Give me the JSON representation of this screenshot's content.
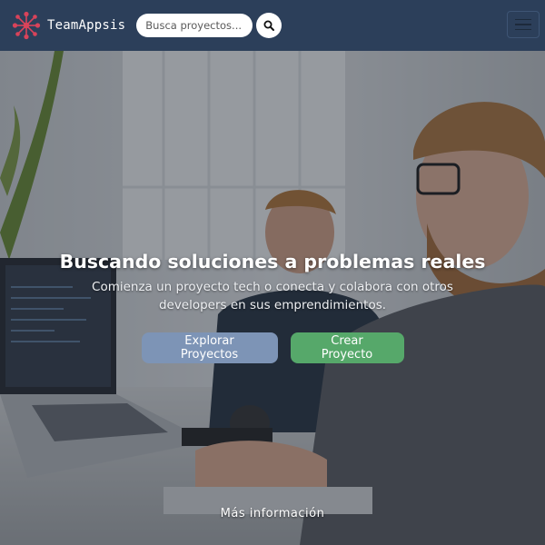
{
  "navbar": {
    "brand_name": "TeamAppsis",
    "logo_icon": "team-network-logo",
    "search_placeholder": "Busca proyectos...",
    "search_icon": "search-icon",
    "menu_icon": "hamburger-menu-icon",
    "colors": {
      "background": "#2c3f5a",
      "logo_accent": "#d9435a"
    }
  },
  "hero": {
    "title": "Buscando soluciones a problemas reales",
    "subtitle": "Comienza un proyecto tech o conecta y colabora con otros developers en sus emprendimientos.",
    "explore_label": "Explorar Proyectos",
    "create_label": "Crear Proyecto",
    "more_info_label": "Más información",
    "colors": {
      "explore_button": "#7d94b6",
      "create_button": "#56a86a"
    }
  }
}
